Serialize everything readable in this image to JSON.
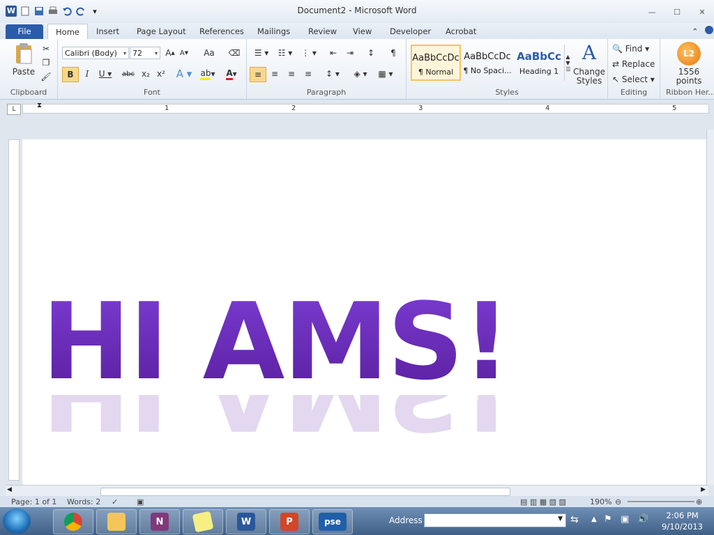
{
  "window": {
    "title": "Document2 - Microsoft Word",
    "min": "—",
    "max": "☐",
    "close": "✕"
  },
  "tabs": [
    "File",
    "Home",
    "Insert",
    "Page Layout",
    "References",
    "Mailings",
    "Review",
    "View",
    "Developer",
    "Acrobat"
  ],
  "ribbon": {
    "clipboard": {
      "label": "Clipboard",
      "paste": "Paste"
    },
    "font": {
      "label": "Font",
      "family": "Calibri (Body)",
      "size": "72",
      "change_case": "Aa"
    },
    "paragraph": {
      "label": "Paragraph"
    },
    "styles": {
      "label": "Styles",
      "items": [
        {
          "preview": "AaBbCcDc",
          "name": "¶ Normal"
        },
        {
          "preview": "AaBbCcDc",
          "name": "¶ No Spaci..."
        },
        {
          "preview": "AaBbCc",
          "name": "Heading 1"
        }
      ],
      "change_styles": "Change Styles"
    },
    "editing": {
      "label": "Editing",
      "find": "Find",
      "replace": "Replace",
      "select": "Select"
    },
    "ribbon_hero": {
      "label": "Ribbon Her...",
      "points": "1556",
      "points_label": "points",
      "level": "L2"
    }
  },
  "ruler": {
    "marks": [
      "1",
      "2",
      "3",
      "4",
      "5"
    ]
  },
  "document": {
    "text": "HI AMS!"
  },
  "statusbar": {
    "page": "Page: 1 of 1",
    "words": "Words: 2",
    "zoom": "190%"
  },
  "taskbar": {
    "address_label": "Address",
    "address_value": "",
    "time": "2:06 PM",
    "date": "9/10/2013",
    "apps": [
      "chrome",
      "explorer",
      "onenote",
      "sticky-notes",
      "word",
      "powerpoint",
      "pse"
    ]
  },
  "colors": {
    "text_purple": "#6a2fb0",
    "file_tab": "#2b5ca9"
  }
}
